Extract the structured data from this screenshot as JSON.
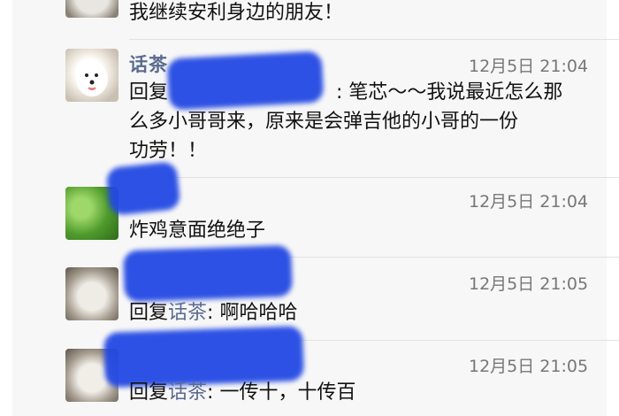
{
  "comments": [
    {
      "name": "",
      "time": "",
      "reply_prefix": "",
      "reply_to": "",
      "text": "我继续安利身边的朋友！"
    },
    {
      "name": "话茶",
      "time": "12月5日 21:04",
      "reply_prefix": "回复",
      "reply_to": "",
      "text_line1": "笔芯～～我说最近怎么那",
      "text_line2": "么多小哥哥来，原来是会弹吉他的小哥的一份",
      "text_line3": "功劳！！"
    },
    {
      "name": "",
      "time": "12月5日 21:04",
      "reply_prefix": "",
      "reply_to": "",
      "text": "炸鸡意面绝绝子"
    },
    {
      "name": "",
      "time": "12月5日 21:05",
      "reply_prefix": "回复",
      "reply_to": "话茶",
      "text": "啊哈哈哈"
    },
    {
      "name": "",
      "time": "12月5日 21:05",
      "reply_prefix": "回复",
      "reply_to": "话茶",
      "text": "一传十，十传百"
    }
  ],
  "colors": {
    "name_link": "#5b6b8f",
    "redaction": "#2349e3",
    "background": "#f7f7f7"
  }
}
